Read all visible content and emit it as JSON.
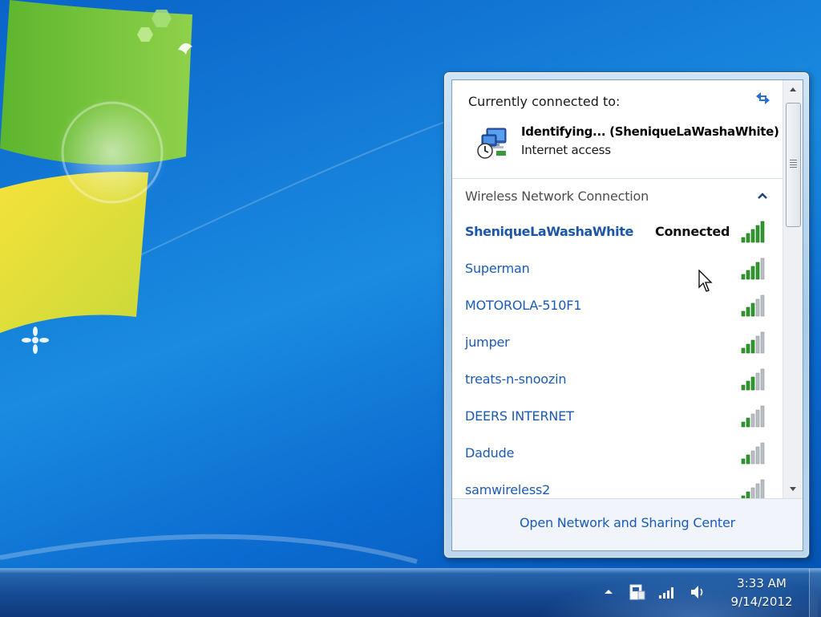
{
  "flyout": {
    "current_label": "Currently connected to:",
    "current_network_name": "Identifying... (SheniqueLaWashaWhite)",
    "current_network_access": "Internet access",
    "refresh_icon": "refresh-arrows-icon",
    "network_icon": "identifying-network-icon",
    "section_label": "Wireless Network Connection",
    "section_toggle_icon": "chevron-up-icon",
    "networks": [
      {
        "name": "SheniqueLaWashaWhite",
        "status": "Connected",
        "signal_bars": 5
      },
      {
        "name": "Superman",
        "status": "",
        "signal_bars": 4
      },
      {
        "name": "MOTOROLA-510F1",
        "status": "",
        "signal_bars": 3
      },
      {
        "name": "jumper",
        "status": "",
        "signal_bars": 3
      },
      {
        "name": "treats-n-snoozin",
        "status": "",
        "signal_bars": 3
      },
      {
        "name": "DEERS INTERNET",
        "status": "",
        "signal_bars": 2
      },
      {
        "name": "Dadude",
        "status": "",
        "signal_bars": 2
      },
      {
        "name": "samwireless2",
        "status": "",
        "signal_bars": 2
      }
    ],
    "footer_link": "Open Network and Sharing Center"
  },
  "taskbar": {
    "tray_icons": [
      "show-hidden-icons-arrow-icon",
      "action-center-flag-icon",
      "wireless-signal-icon",
      "speaker-volume-icon"
    ],
    "time": "3:33 AM",
    "date": "9/14/2012"
  },
  "colors": {
    "link_blue": "#1a5bb5",
    "signal_green": "#2e9a2e",
    "signal_gray": "#b9bec4",
    "desktop_blue": "#1a8be0"
  }
}
